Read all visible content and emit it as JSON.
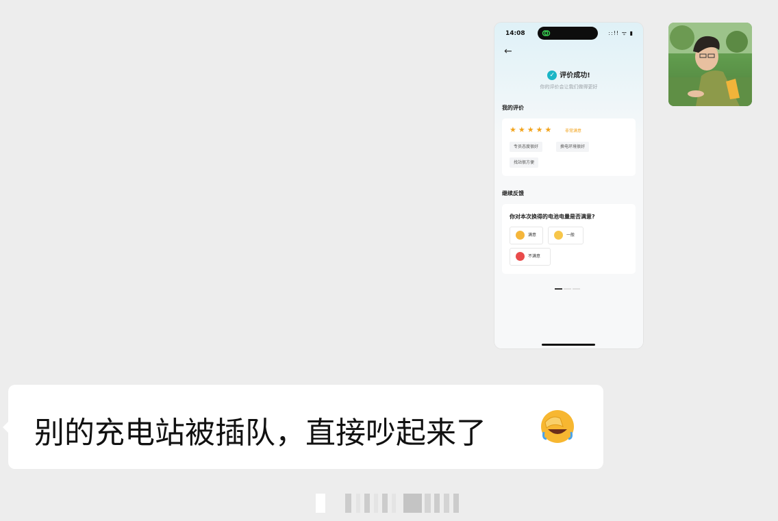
{
  "phone_screenshot": {
    "status_time": "14:08",
    "status_icons": "::!! ᯤ ▮",
    "back_icon": "arrow-left-icon",
    "success_title": "评价成功!",
    "success_subtitle": "你的评价会让我们做得更好",
    "my_review": {
      "section_title": "我的评价",
      "rating_value": 5,
      "rating_max": 5,
      "rating_label": "非常满意",
      "tags": [
        "专员态度很好",
        "换电环境很好",
        "找站很方便"
      ]
    },
    "feedback": {
      "section_title": "继续反馈",
      "question": "你对本次换得的电池电量是否满意?",
      "options": [
        "满意",
        "一般",
        "不满意"
      ]
    },
    "page_indicator": {
      "total": 3,
      "active": 1
    }
  },
  "message": {
    "text": "别的充电站被插队，直接吵起来了",
    "emoji": "facepalm-laughing-emoji"
  },
  "colors": {
    "chat_background": "#ededed",
    "bubble": "#ffffff",
    "accent_teal": "#1bb5c6",
    "star": "#f2a31b"
  }
}
